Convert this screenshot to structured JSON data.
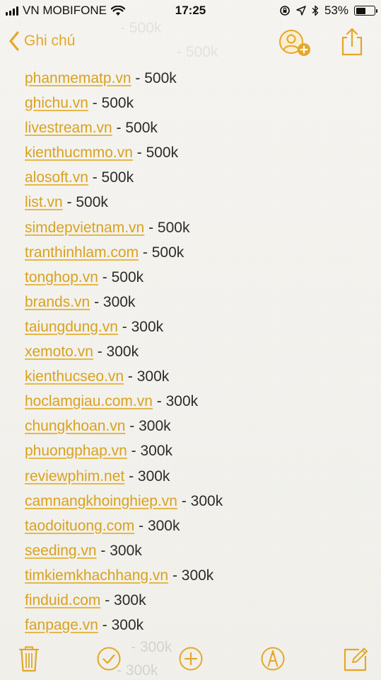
{
  "status_bar": {
    "carrier": "VN MOBIFONE",
    "time": "17:25",
    "battery_percent": "53%",
    "battery_level": 0.53
  },
  "nav": {
    "back_label": "Ghi chú"
  },
  "note": {
    "items": [
      {
        "link": "phanmematp.vn",
        "price": " - 500k"
      },
      {
        "link": "ghichu.vn",
        "price": " - 500k"
      },
      {
        "link": "livestream.vn",
        "price": " - 500k"
      },
      {
        "link": "kienthucmmo.vn",
        "price": " - 500k"
      },
      {
        "link": "alosoft.vn",
        "price": " - 500k"
      },
      {
        "link": "list.vn",
        "price": " - 500k"
      },
      {
        "link": "simdepvietnam.vn",
        "price": " - 500k"
      },
      {
        "link": "tranthinhlam.com",
        "price": " - 500k"
      },
      {
        "link": "tonghop.vn",
        "price": " - 500k"
      },
      {
        "link": "brands.vn",
        "price": " - 300k"
      },
      {
        "link": "taiungdung.vn",
        "price": " - 300k"
      },
      {
        "link": "xemoto.vn",
        "price": " - 300k"
      },
      {
        "link": "kienthucseo.vn",
        "price": " - 300k"
      },
      {
        "link": "hoclamgiau.com.vn",
        "price": " - 300k"
      },
      {
        "link": "chungkhoan.vn",
        "price": " - 300k"
      },
      {
        "link": "phuongphap.vn",
        "price": " - 300k"
      },
      {
        "link": "reviewphim.net",
        "price": " - 300k"
      },
      {
        "link": "camnangkhoinghiep.vn",
        "price": " - 300k"
      },
      {
        "link": "taodoituong.com",
        "price": " - 300k"
      },
      {
        "link": "seeding.vn",
        "price": " - 300k"
      },
      {
        "link": "timkiemkhachhang.vn",
        "price": " - 300k"
      },
      {
        "link": "finduid.com",
        "price": " - 300k"
      },
      {
        "link": "fanpage.vn",
        "price": " - 300k"
      }
    ]
  },
  "toolbar": {
    "icons": [
      "trash-icon",
      "checklist-icon",
      "add-icon",
      "markup-icon",
      "compose-icon"
    ]
  },
  "colors": {
    "accent": "#e4a728",
    "link": "#d9a21f",
    "text": "#2b2b2b",
    "background": "#f4f3ef"
  }
}
